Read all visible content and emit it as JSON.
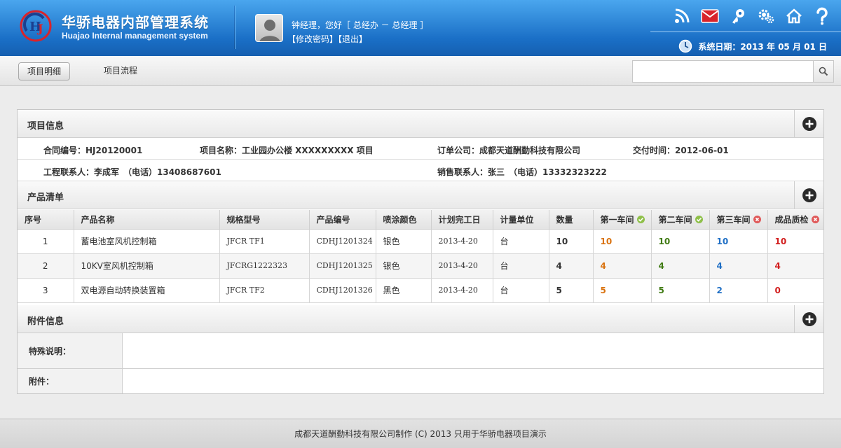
{
  "app": {
    "title": "华骄电器内部管理系统",
    "subtitle": "Huajao Internal management system"
  },
  "user": {
    "greeting": "钟经理，您好［ 总经办 － 总经理 ］",
    "change_password": "【修改密码】",
    "logout": "【退出】"
  },
  "header_icons": [
    "rss-icon",
    "mail-icon",
    "key-icon",
    "settings-icon",
    "home-icon",
    "help-icon"
  ],
  "system_date": "系统日期：2013 年 05 月 01 日",
  "tabs": [
    {
      "label": "项目明细",
      "active": true
    },
    {
      "label": "项目流程",
      "active": false
    }
  ],
  "search": {
    "placeholder": "",
    "value": ""
  },
  "project_info": {
    "title": "项目信息",
    "contract_no": "合同编号：HJ20120001",
    "project_name": "项目名称：工业园办公楼 XXXXXXXXX 项目",
    "order_company": "订单公司：成都天道酬勤科技有限公司",
    "delivery_time": "交付时间：2012-06-01",
    "engineering_contact": "工程联系人：李成军　（电话）13408687601",
    "sales_contact": "销售联系人：张三　（电话）13332323222"
  },
  "product_list": {
    "title": "产品清单",
    "headers": [
      "序号",
      "产品名称",
      "规格型号",
      "产品编号",
      "喷涂颜色",
      "计划完工日",
      "计量单位",
      "数量",
      "第一车间",
      "第二车间",
      "第三车间",
      "成品质检"
    ],
    "header_status": {
      "第一车间": "ok",
      "第二车间": "ok",
      "第三车间": "error",
      "成品质检": "error"
    },
    "rows": [
      [
        "1",
        "蓄电池室风机控制箱",
        "JFCR TF1",
        "CDHJ1201324",
        "银色",
        "2013-4-20",
        "台",
        "10",
        "10",
        "10",
        "10",
        "10"
      ],
      [
        "2",
        "10KV室风机控制箱",
        "JFCRG1222323",
        "CDHJ1201325",
        "银色",
        "2013-4-20",
        "台",
        "4",
        "4",
        "4",
        "4",
        "4"
      ],
      [
        "3",
        "双电源自动转换装置箱",
        "JFCR TF2",
        "CDHJ1201326",
        "黑色",
        "2013-4-20",
        "台",
        "5",
        "5",
        "5",
        "2",
        "0"
      ]
    ]
  },
  "attachments": {
    "title": "附件信息",
    "special_note_label": "特殊说明：",
    "attachment_label": "附件："
  },
  "colors": {
    "workshop1": "#d9720f",
    "workshop2": "#3f7a12",
    "workshop3": "#1f6fc5",
    "qc": "#d21e1e",
    "ok": "#8fc04a",
    "error": "#e05a5a"
  },
  "footer": "成都天道酬勤科技有限公司制作 (C) 2013 只用于华骄电器项目演示"
}
